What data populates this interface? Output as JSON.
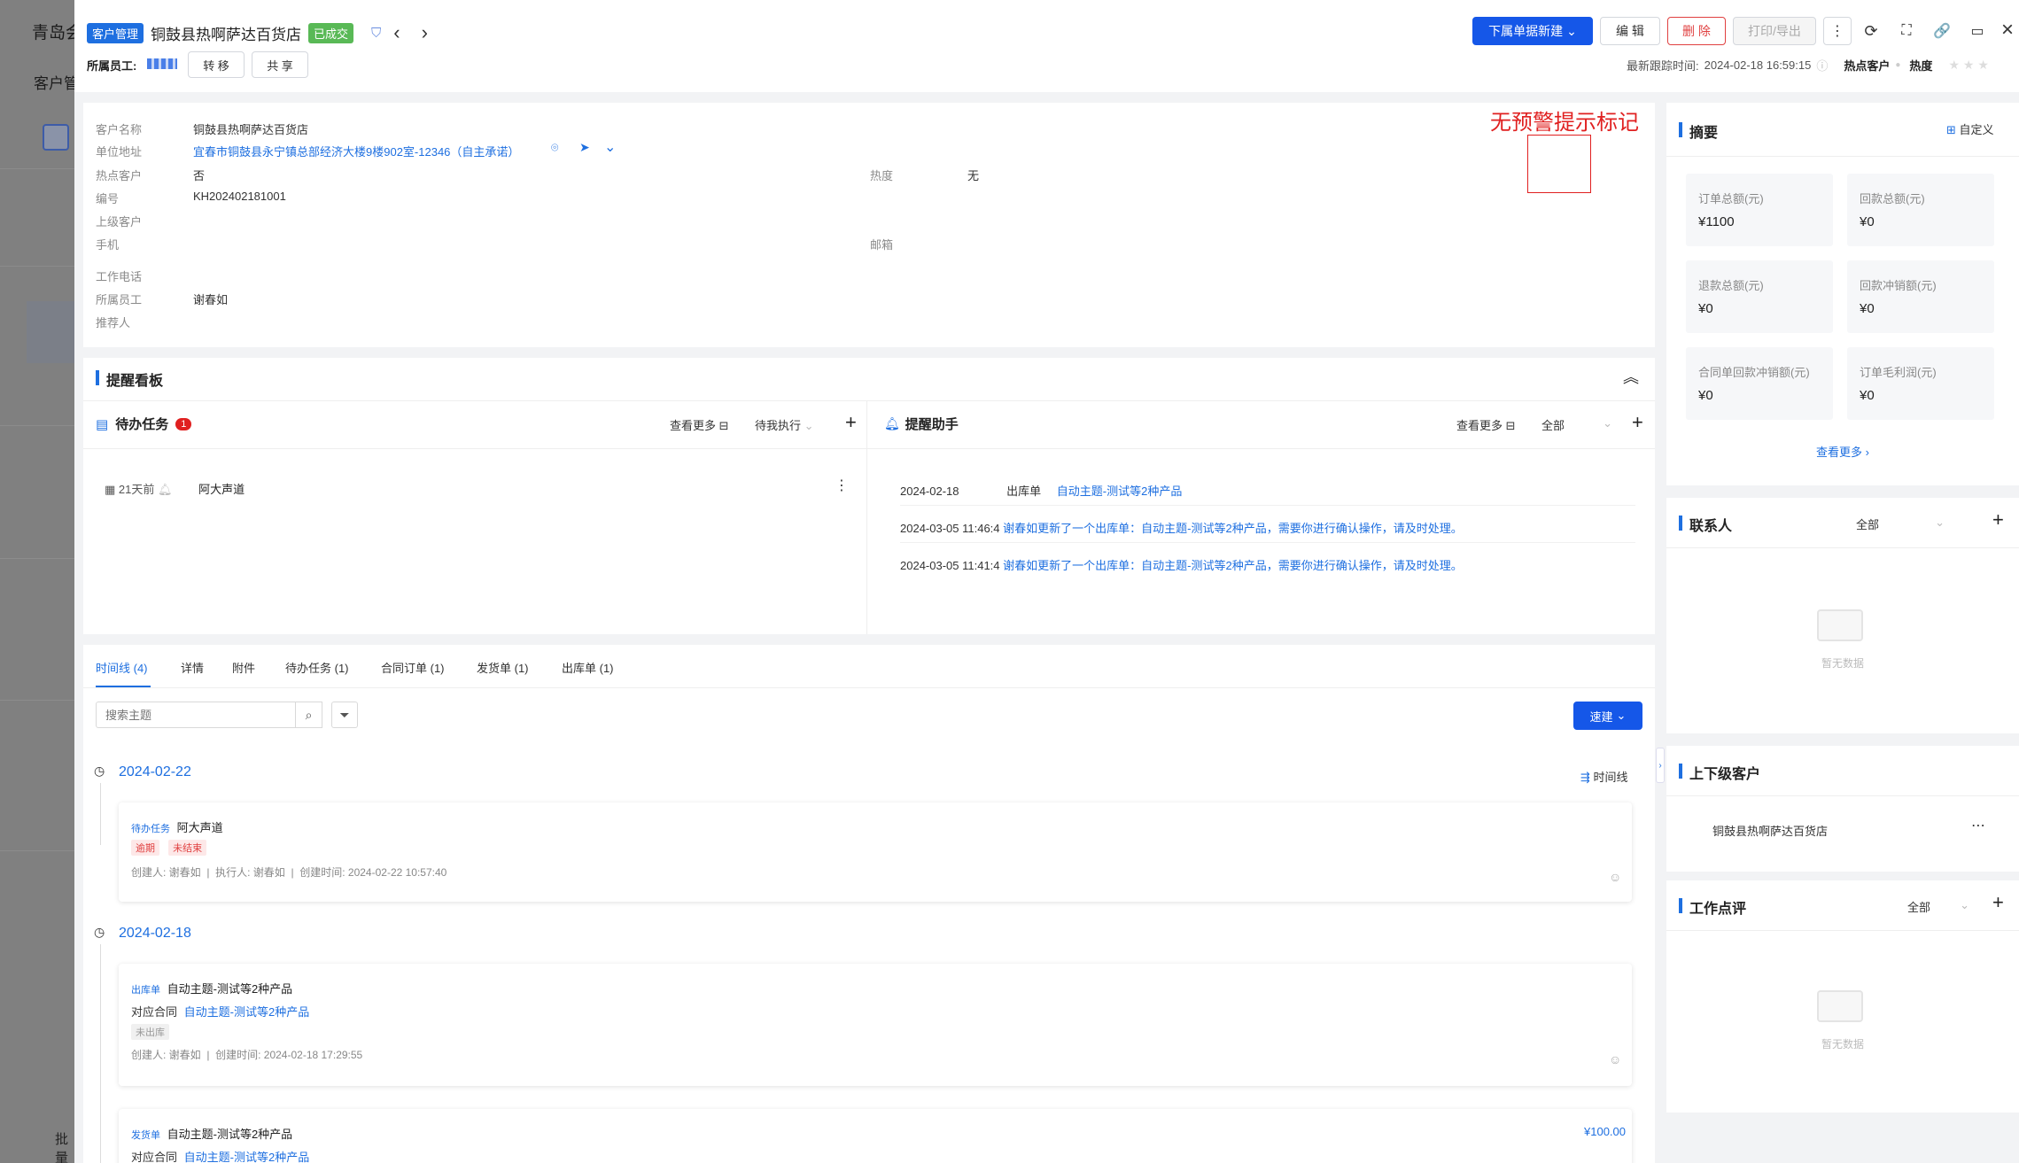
{
  "background": {
    "title": "青岛会",
    "subtitle": "客户管",
    "bottom_button": "批量"
  },
  "header": {
    "module_tag": "客户管理",
    "customer_name": "铜鼓县热啊萨达百货店",
    "status_tag": "已成交",
    "owner_label": "所属员工:",
    "transfer_button": "转 移",
    "share_button": "共 享",
    "create_sub_button": "下属单据新建",
    "edit_button": "编 辑",
    "delete_button": "删 除",
    "print_button": "打印/导出",
    "last_follow_label": "最新跟踪时间:",
    "last_follow_time": "2024-02-18 16:59:15",
    "hot_customer_label": "热点客户",
    "heat_label": "热度"
  },
  "info": {
    "rows": [
      {
        "label": "客户名称",
        "value": "铜鼓县热啊萨达百货店"
      },
      {
        "label": "单位地址",
        "value": "宜春市铜鼓县永宁镇总部经济大楼9楼902室-12346（自主承诺）"
      },
      {
        "label": "热点客户",
        "value": "否"
      },
      {
        "label": "编号",
        "value": "KH202402181001"
      },
      {
        "label": "上级客户",
        "value": ""
      },
      {
        "label": "手机",
        "value": ""
      },
      {
        "label": "工作电话",
        "value": ""
      },
      {
        "label": "所属员工",
        "value": "谢春如"
      },
      {
        "label": "推荐人",
        "value": ""
      }
    ],
    "heat_label": "热度",
    "heat_value": "无",
    "email_label": "邮箱",
    "annotation": "无预警提示标记"
  },
  "reminder_board": {
    "title": "提醒看板",
    "todo": {
      "title": "待办任务",
      "badge": "1",
      "more": "查看更多",
      "filter": "待我执行",
      "item_time": "21天前",
      "item_title": "阿大声道"
    },
    "assistant": {
      "title": "提醒助手",
      "more": "查看更多",
      "filter": "全部",
      "items": [
        {
          "date": "2024-02-18",
          "type": "出库单",
          "text": "自动主题-测试等2种产品"
        },
        {
          "date": "2024-03-05 11:46:4",
          "type": "",
          "text": "谢春如更新了一个出库单：自动主题-测试等2种产品，需要你进行确认操作，请及时处理。"
        },
        {
          "date": "2024-03-05 11:41:4",
          "type": "",
          "text": "谢春如更新了一个出库单：自动主题-测试等2种产品，需要你进行确认操作，请及时处理。"
        }
      ]
    }
  },
  "tabs": [
    "时间线 (4)",
    "详情",
    "附件",
    "待办任务 (1)",
    "合同订单 (1)",
    "发货单 (1)",
    "出库单 (1)"
  ],
  "timeline": {
    "search_placeholder": "搜索主题",
    "quick_create": "速建",
    "view_label": "时间线",
    "groups": [
      {
        "date": "2024-02-22",
        "card": {
          "type": "待办任务",
          "title": "阿大声道",
          "chips": [
            "逾期",
            "未结束"
          ],
          "meta": "创建人: 谢春如  |  执行人: 谢春如  |  创建时间: 2024-02-22 10:57:40"
        }
      },
      {
        "date": "2024-02-18",
        "card": {
          "type": "出库单",
          "title": "自动主题-测试等2种产品",
          "contract_label": "对应合同",
          "contract": "自动主题-测试等2种产品",
          "chip": "未出库",
          "meta": "创建人: 谢春如  |  创建时间: 2024-02-18 17:29:55"
        },
        "card2": {
          "type": "发货单",
          "title": "自动主题-测试等2种产品",
          "contract_label": "对应合同",
          "contract": "自动主题-测试等2种产品",
          "amount": "¥100.00"
        }
      }
    ]
  },
  "summary": {
    "title": "摘要",
    "customize": "自定义",
    "stats": [
      {
        "label": "订单总额(元)",
        "value": "¥1100"
      },
      {
        "label": "回款总额(元)",
        "value": "¥0"
      },
      {
        "label": "退款总额(元)",
        "value": "¥0"
      },
      {
        "label": "回款冲销额(元)",
        "value": "¥0"
      },
      {
        "label": "合同单回款冲销额(元)",
        "value": "¥0"
      },
      {
        "label": "订单毛利润(元)",
        "value": "¥0"
      }
    ],
    "more": "查看更多"
  },
  "contacts": {
    "title": "联系人",
    "filter": "全部",
    "empty": "暂无数据"
  },
  "relations": {
    "title": "上下级客户",
    "item": "铜鼓县热啊萨达百货店"
  },
  "reviews": {
    "title": "工作点评",
    "filter": "全部",
    "empty": "暂无数据"
  },
  "colors": {
    "primary": "#1557e8",
    "link": "#1e6fe0",
    "success": "#59b956",
    "danger": "#e04040",
    "annotation": "#e02020"
  }
}
